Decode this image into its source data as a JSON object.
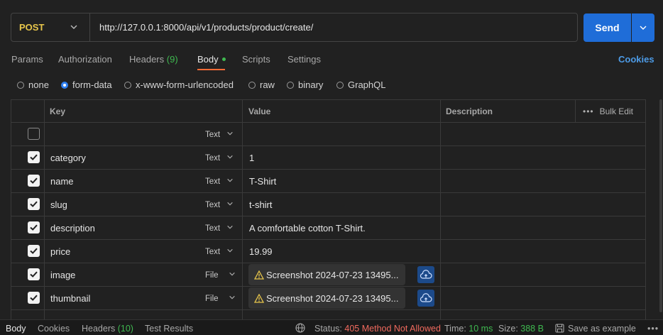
{
  "request": {
    "method": "POST",
    "url": "http://127.0.0.1:8000/api/v1/products/product/create/",
    "send_label": "Send"
  },
  "tabs": [
    {
      "label": "Params"
    },
    {
      "label": "Authorization"
    },
    {
      "label": "Headers",
      "count": "(9)"
    },
    {
      "label": "Body",
      "active": true
    },
    {
      "label": "Scripts"
    },
    {
      "label": "Settings"
    }
  ],
  "cookies_label": "Cookies",
  "body_types": [
    {
      "label": "none",
      "selected": false
    },
    {
      "label": "form-data",
      "selected": true
    },
    {
      "label": "x-www-form-urlencoded",
      "selected": false
    },
    {
      "label": "raw",
      "selected": false
    },
    {
      "label": "binary",
      "selected": false
    },
    {
      "label": "GraphQL",
      "selected": false
    }
  ],
  "table": {
    "headers": {
      "key": "Key",
      "value": "Value",
      "description": "Description",
      "bulk_edit": "Bulk Edit"
    },
    "rows": [
      {
        "checked": false,
        "key": "",
        "type": "Text",
        "value": ""
      },
      {
        "checked": true,
        "key": "category",
        "type": "Text",
        "value": "1"
      },
      {
        "checked": true,
        "key": "name",
        "type": "Text",
        "value": "T-Shirt"
      },
      {
        "checked": true,
        "key": "slug",
        "type": "Text",
        "value": "t-shirt"
      },
      {
        "checked": true,
        "key": "description",
        "type": "Text",
        "value": "A comfortable cotton T-Shirt."
      },
      {
        "checked": true,
        "key": "price",
        "type": "Text",
        "value": "19.99"
      },
      {
        "checked": true,
        "key": "image",
        "type": "File",
        "value": "Screenshot 2024-07-23 13495..."
      },
      {
        "checked": true,
        "key": "thumbnail",
        "type": "File",
        "value": "Screenshot 2024-07-23 13495..."
      }
    ]
  },
  "footer": {
    "tabs": [
      {
        "label": "Body",
        "active": true
      },
      {
        "label": "Cookies"
      },
      {
        "label": "Headers",
        "count": "(10)"
      },
      {
        "label": "Test Results"
      }
    ],
    "status_label": "Status:",
    "status_value": "405 Method Not Allowed",
    "time_label": "Time:",
    "time_value": "10 ms",
    "size_label": "Size:",
    "size_value": "388 B",
    "save_label": "Save as example"
  },
  "colors": {
    "accent": "#1f6dd8",
    "method": "#e8c64b",
    "active_tab_underline": "#ff6c37",
    "status_error": "#f16a5e",
    "ok_green": "#3fb950"
  }
}
